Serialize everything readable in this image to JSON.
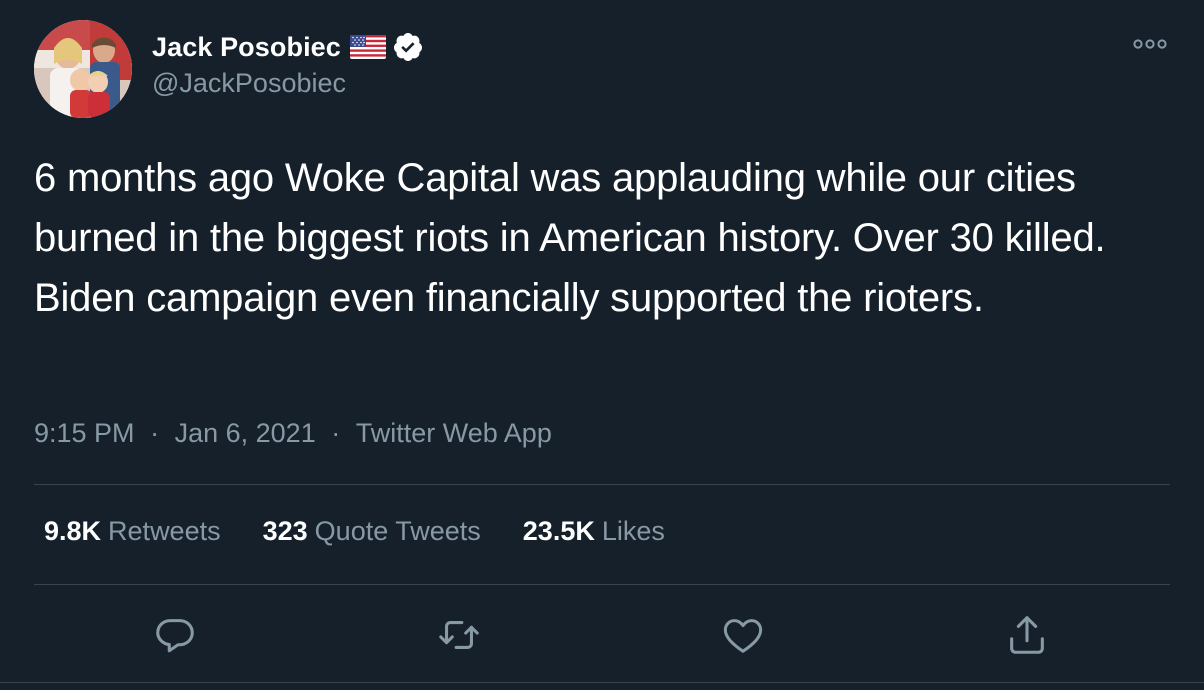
{
  "author": {
    "display_name": "Jack Posobiec",
    "handle": "@JackPosobiec",
    "flag_icon": "us-flag-icon",
    "verified_icon": "verified-badge-icon"
  },
  "tweet": {
    "text": "6 months ago Woke Capital was applauding while our cities burned in the biggest riots in American history. Over 30 killed. Biden campaign even financially supported the rioters.",
    "time": "9:15 PM",
    "separator": "·",
    "date": "Jan 6, 2021",
    "source": "Twitter Web App"
  },
  "stats": {
    "retweets_count": "9.8K",
    "retweets_label": "Retweets",
    "quotes_count": "323",
    "quotes_label": "Quote Tweets",
    "likes_count": "23.5K",
    "likes_label": "Likes"
  },
  "actions": [
    "reply-icon",
    "retweet-icon",
    "like-icon",
    "share-icon"
  ],
  "colors": {
    "background": "#15202b",
    "text_primary": "#ffffff",
    "text_secondary": "#8899a6",
    "divider": "#38444d"
  }
}
